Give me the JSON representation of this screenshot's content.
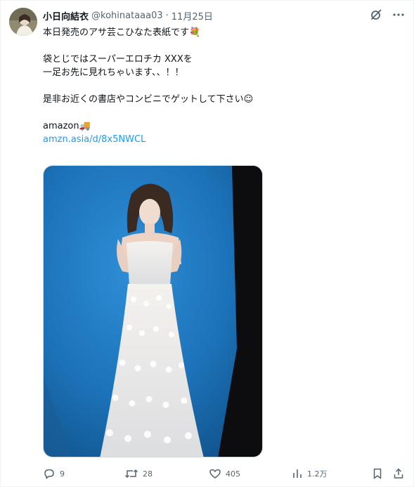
{
  "tweet": {
    "display_name": "小日向結衣",
    "handle": "@kohinataaa03",
    "separator": "·",
    "date": "11月25日",
    "lines": {
      "l1": "本日発売のアサ芸こひなた表紙です💐",
      "l2": "袋とじではスーパーエロチカ XXXを",
      "l3": "一足お先に見れちゃいます、、！！",
      "l4": "是非お近くの書店やコンビニでゲットして下さい☺",
      "l5": "amazon",
      "l5_emoji": "🚚",
      "link": "amzn.asia/d/8x5NWCL"
    },
    "icons": {
      "grok": "grok-icon",
      "more": "more-icon"
    }
  },
  "actions": {
    "replies": "9",
    "reposts": "28",
    "likes": "405",
    "views": "1.2万"
  },
  "colors": {
    "link": "#1d9bf0",
    "muted": "#536471",
    "text": "#0f1419",
    "photo_bg": "#1b6fb3"
  }
}
